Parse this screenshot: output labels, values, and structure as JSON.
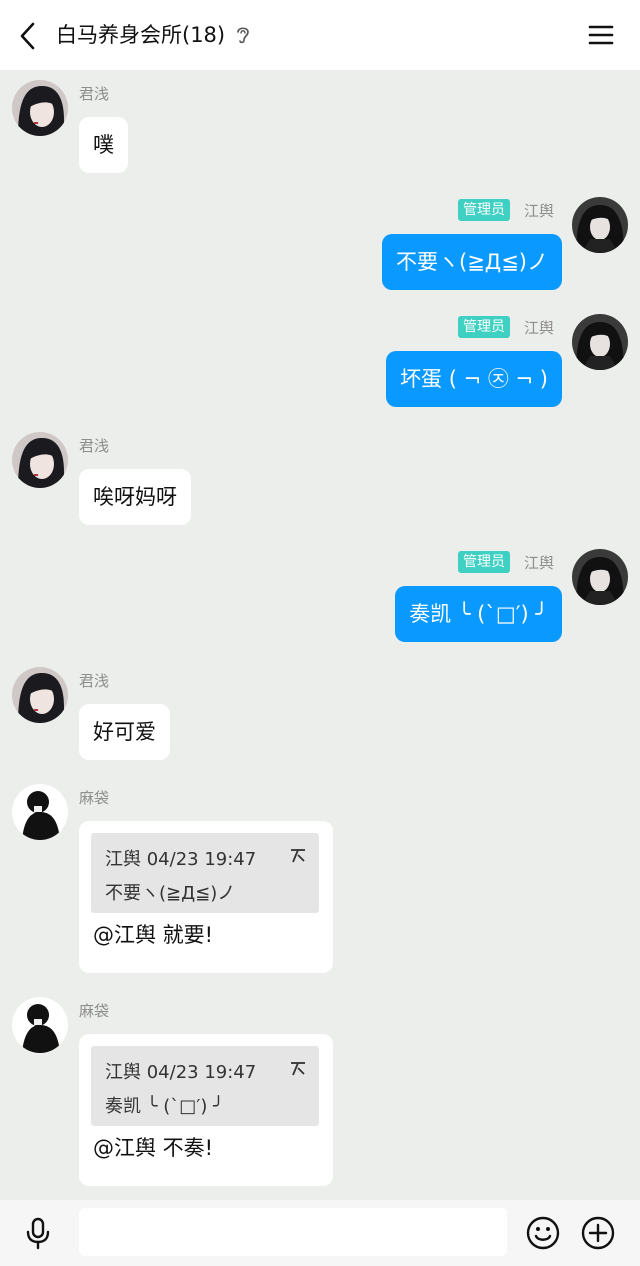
{
  "header": {
    "title": "白马养身会所(18)"
  },
  "messages": [
    {
      "sender": "君浅",
      "direction": "in",
      "text": "噗"
    },
    {
      "sender": "江舆",
      "badge": "管理员",
      "direction": "out",
      "text": "不要ヽ(≧Д≦)ノ"
    },
    {
      "sender": "江舆",
      "badge": "管理员",
      "direction": "out",
      "text": "坏蛋 ( ¬ ㉨ ¬ )"
    },
    {
      "sender": "君浅",
      "direction": "in",
      "text": "唉呀妈呀"
    },
    {
      "sender": "江舆",
      "badge": "管理员",
      "direction": "out",
      "text": "奏凯 ╰ (`□′) ╯"
    },
    {
      "sender": "君浅",
      "direction": "in",
      "text": "好可爱"
    },
    {
      "sender": "麻袋",
      "direction": "in",
      "type": "reply",
      "quote_meta": "江舆 04/23 19:47",
      "quote_text": "不要ヽ(≧Д≦)ノ",
      "text": "@江舆 就要!"
    },
    {
      "sender": "麻袋",
      "direction": "in",
      "type": "reply",
      "quote_meta": "江舆 04/23 19:47",
      "quote_text": "奏凯 ╰ (`□′) ╯",
      "text": "@江舆 不奏!"
    }
  ],
  "input": {
    "placeholder": "",
    "value": ""
  },
  "icons": {
    "back": "chevron-left-icon",
    "listen_mode": "ear-icon",
    "menu": "menu-icon",
    "mic": "microphone-icon",
    "emoji": "smiley-icon",
    "plus": "plus-circle-icon",
    "quote": "quote-icon"
  },
  "colors": {
    "outgoing_bubble": "#0a99ff",
    "admin_badge": "#3fd0c4",
    "chat_background": "#ebeeea"
  }
}
